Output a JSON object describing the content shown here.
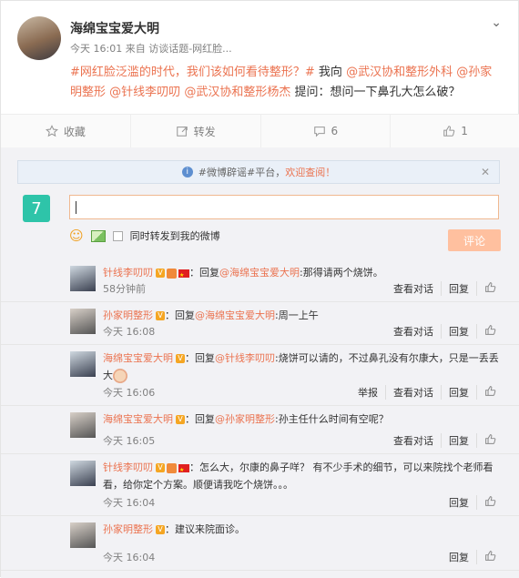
{
  "post": {
    "author": "海绵宝宝爱大明",
    "meta": "今天 16:01 来自 访谈话题-网红脸...",
    "text_parts": [
      {
        "text": "#网红脸泛滥的时代，我们该如何看待整形？#",
        "hl": true
      },
      {
        "text": " 我向 ",
        "hl": false
      },
      {
        "text": "@武汉协和整形外科",
        "hl": true
      },
      {
        "text": " ",
        "hl": false
      },
      {
        "text": "@孙家明整形",
        "hl": true
      },
      {
        "text": " ",
        "hl": false
      },
      {
        "text": "@针线李叨叨",
        "hl": true
      },
      {
        "text": " ",
        "hl": false
      },
      {
        "text": "@武汉协和整形杨杰",
        "hl": true
      },
      {
        "text": " 提问：想问一下鼻孔大怎么破？",
        "hl": false
      }
    ]
  },
  "actions": {
    "favorite": "收藏",
    "repost": "转发",
    "comment_count": "6",
    "like_count": "1"
  },
  "notice": {
    "hashtag": "#微博辟谣#平台，",
    "welcome": "欢迎查阅！"
  },
  "composer": {
    "also_repost": "同时转发到我的微博",
    "submit": "评论"
  },
  "ops": {
    "view_conversation": "查看对话",
    "reply": "回复",
    "report": "举报"
  },
  "comments": [
    {
      "user": "针线李叨叨",
      "pre": "：回复",
      "mention": "@海绵宝宝爱大明",
      "text": ":那得请两个烧饼。",
      "time": "58分钟前",
      "badges": true,
      "report": false,
      "conversation": true
    },
    {
      "user": "孙家明整形",
      "pre": "：回复",
      "mention": "@海绵宝宝爱大明",
      "text": ":周一上午",
      "time": "今天 16:08",
      "badges": false,
      "report": false,
      "conversation": true
    },
    {
      "user": "海绵宝宝爱大明",
      "pre": "：回复",
      "mention": "@针线李叨叨",
      "text": ":烧饼可以请的，不过鼻孔没有尔康大，只是一丢丢大",
      "time": "今天 16:06",
      "badges": false,
      "report": true,
      "conversation": true
    },
    {
      "user": "海绵宝宝爱大明",
      "pre": "：回复",
      "mention": "@孙家明整形",
      "text": ":孙主任什么时间有空呢？",
      "time": "今天 16:05",
      "badges": false,
      "report": false,
      "conversation": true
    },
    {
      "user": "针线李叨叨",
      "pre": "：",
      "mention": "",
      "text": "怎么大，尔康的鼻子咩？ 有不少手术的细节，可以来院找个老师看看，给你定个方案。顺便请我吃个烧饼。。。",
      "time": "今天 16:04",
      "badges": true,
      "report": false,
      "conversation": false
    },
    {
      "user": "孙家明整形",
      "pre": "：",
      "mention": "",
      "text": "建议来院面诊。",
      "time": "今天 16:04",
      "badges": false,
      "report": false,
      "conversation": false
    }
  ]
}
